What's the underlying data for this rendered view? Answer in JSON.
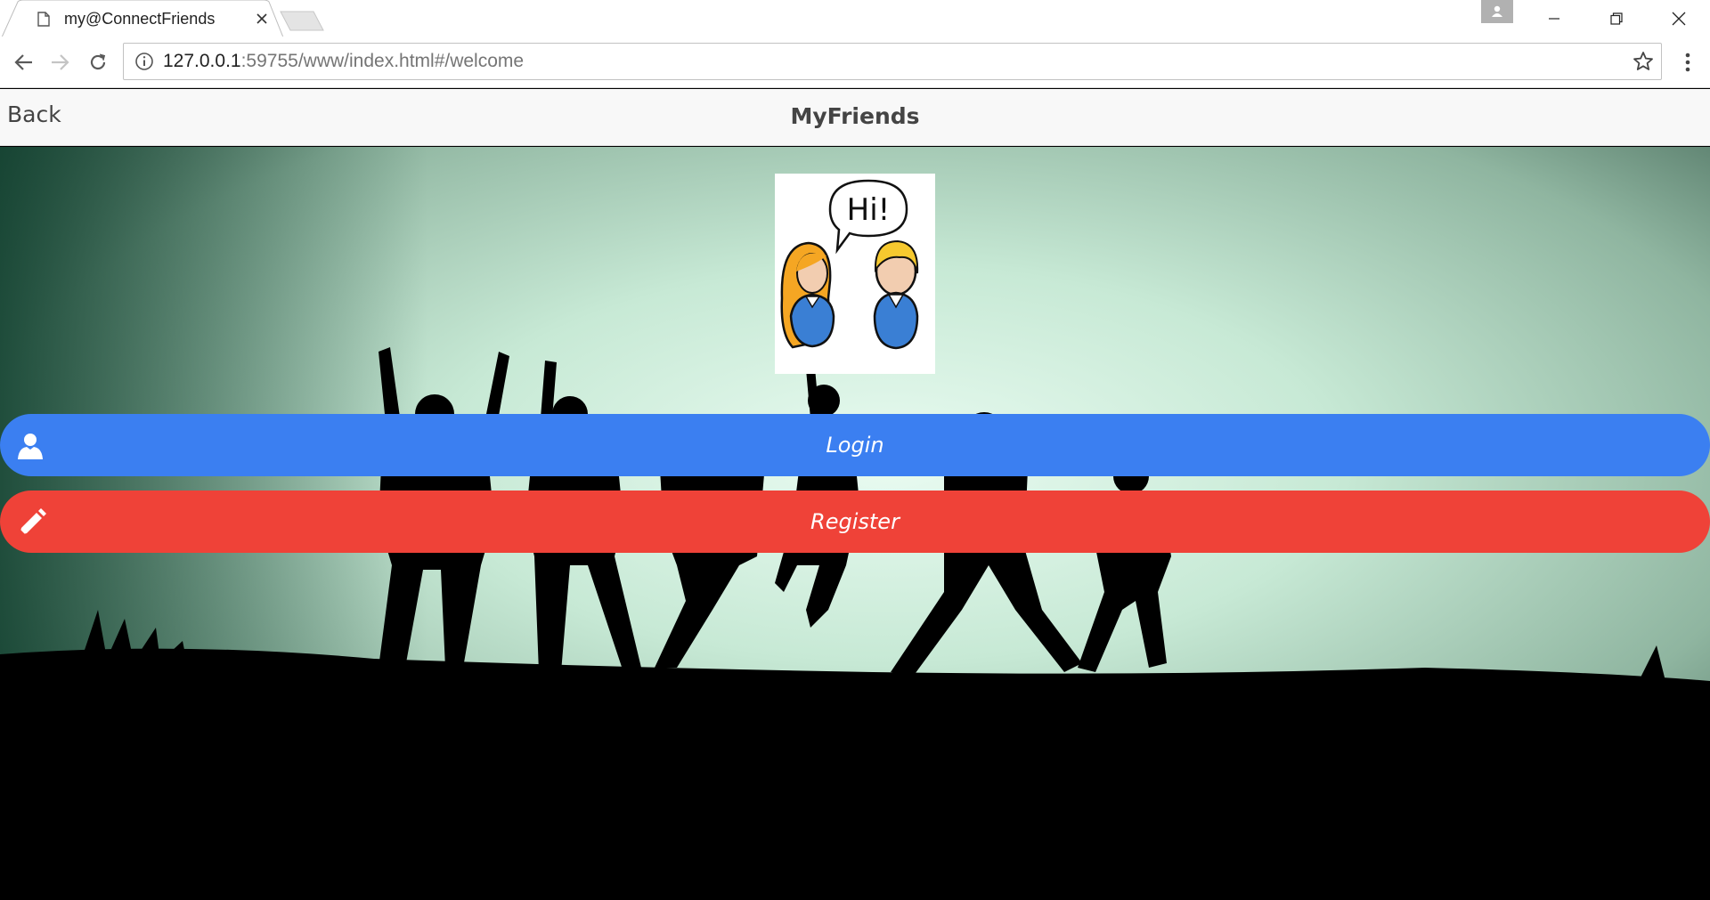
{
  "browser": {
    "tab_title": "my@ConnectFriends",
    "url_host": "127.0.0.1",
    "url_rest": ":59755/www/index.html#/welcome"
  },
  "app": {
    "back_label": "Back",
    "title": "MyFriends",
    "logo_speech": "Hi!",
    "login_label": "Login",
    "register_label": "Register"
  },
  "colors": {
    "login": "#3b7ff1",
    "register": "#ef4238",
    "header_bg": "#f8f8f8"
  }
}
